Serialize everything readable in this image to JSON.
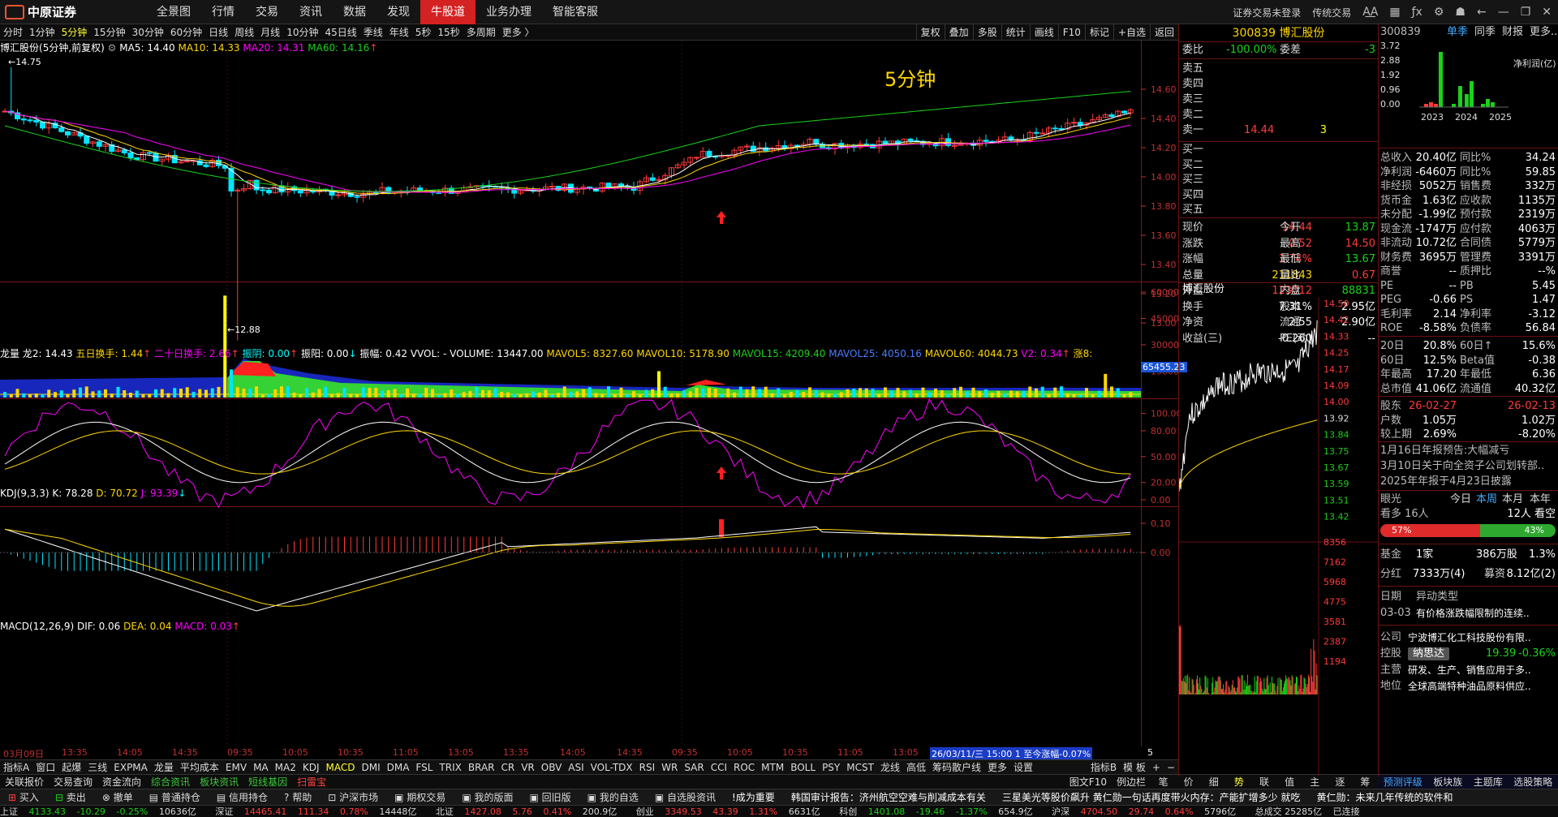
{
  "topbar": {
    "logo": "中原证券",
    "nav": [
      "全景图",
      "行情",
      "交易",
      "资讯",
      "数据",
      "发现",
      "牛股道",
      "业务办理",
      "智能客服"
    ],
    "active": "牛股道",
    "right": {
      "login": "证券交易未登录",
      "mode": "传统交易",
      "font": "A͜A"
    }
  },
  "periods": [
    "分时",
    "1分钟",
    "5分钟",
    "15分钟",
    "30分钟",
    "60分钟",
    "日线",
    "周线",
    "月线",
    "10分钟",
    "45日线",
    "季线",
    "年线",
    "5秒",
    "15秒",
    "多周期",
    "更多 〉"
  ],
  "active_period": "5分钟",
  "chart_tools": [
    "复权",
    "叠加",
    "多股",
    "统计",
    "画线",
    "F10",
    "标记",
    "+自选",
    "返回"
  ],
  "main": {
    "header": {
      "name": "博汇股份",
      "desc": "(5分钟,前复权)",
      "ma5": "MA5: 14.40",
      "ma10": "MA10: 14.33",
      "ma20": "MA20: 14.31",
      "ma60": "MA60: 14.16"
    },
    "period_label": "5分钟",
    "high_mark": "14.75",
    "low_mark": "12.88",
    "y_ticks": [
      "14.60",
      "14.40",
      "14.20",
      "14.00",
      "13.80",
      "13.60",
      "13.40",
      "13.20",
      "13.00"
    ]
  },
  "vol": {
    "header": {
      "name": "龙量",
      "l2": "龙2: 14.43",
      "l3": "五日换手: 1.44",
      "l4": "二十日换手: 2.66",
      "l5": "振阴: 0.00",
      "l6": "振阳: 0.00",
      "l7": "振幅: 0.42",
      "l8": "VVOL: - VOLUME: 13447.00",
      "l9": "MAVOL5: 8327.60",
      "l10": "MAVOL10: 5178.90",
      "l11": "MAVOL15: 4209.40",
      "l12": "MAVOL25: 4050.16",
      "l13": "MAVOL60: 4044.73",
      "l14": "V2: 0.34",
      "l15": "涨8:"
    },
    "top_badge": "65455.23",
    "y_ticks": [
      "60000",
      "45000",
      "30000",
      "15000"
    ]
  },
  "kdj": {
    "header": {
      "name": "KDJ(9,3,3)",
      "k": "K: 78.28",
      "d": "D: 70.72",
      "j": "J: 93.39"
    },
    "y_ticks": [
      "100.00",
      "80.00",
      "50.00",
      "20.00",
      "0.00"
    ]
  },
  "macd": {
    "header": {
      "name": "MACD(12,26,9)",
      "dif": "DIF: 0.06",
      "dea": "DEA: 0.04",
      "macd": "MACD: 0.03"
    },
    "y_ticks": [
      "0.10",
      "0.00"
    ]
  },
  "time_axis": {
    "labels": [
      "03月09日",
      "13:35",
      "14:05",
      "14:35",
      "09:35",
      "10:05",
      "10:35",
      "11:05",
      "13:05",
      "13:35",
      "14:05",
      "14:35",
      "09:35",
      "10:05",
      "10:35",
      "11:05",
      "13:05"
    ],
    "cursor": "26/03/11/三 15:00 1 至今涨幅-0.07%",
    "period": "5分钟"
  },
  "tabs": [
    "指标A",
    "窗口",
    "起爆",
    "三线",
    "EXPMA",
    "龙量",
    "平均成本",
    "EMV",
    "MA",
    "MA2",
    "KDJ",
    "MACD",
    "DMI",
    "DMA",
    "FSL",
    "TRIX",
    "BRAR",
    "CR",
    "VR",
    "OBV",
    "ASI",
    "VOL-TDX",
    "RSI",
    "WR",
    "SAR",
    "CCI",
    "ROC",
    "MTM",
    "BOLL",
    "PSY",
    "MCST",
    "龙线",
    "高低",
    "筹码散户线",
    "更多",
    "设置"
  ],
  "active_tab": "MACD",
  "tabs_right": [
    "指标B",
    "模 板",
    "+",
    "−"
  ],
  "funcbar": [
    "关联报价",
    "交易查询",
    "资金流向",
    "综合资讯",
    "板块资讯",
    "短线基因",
    "扫雷宝"
  ],
  "funcbar_right": [
    "图文F10",
    "例边栏"
  ],
  "funcbar_right_tabs": [
    "笔",
    "价",
    "细",
    "势",
    "联",
    "值",
    "主",
    "逐",
    "筹"
  ],
  "tradebar": [
    "买入",
    "卖出",
    "撤单",
    "普通持仓",
    "信用持仓",
    "帮助",
    "沪深市场",
    "期权交易",
    "我的版面",
    "回旧版",
    "我的自选",
    "自选股资讯"
  ],
  "news": [
    "!成为重要",
    "韩国审计报告：济州航空空难与削减成本有关",
    "三星美光等股价飙升 黄仁勋一句话再度带火内存：产能扩增多少 就吃",
    "黄仁勋：未来几年传统的软件和"
  ],
  "status": {
    "sh": "上证",
    "sh_v": "4133.43",
    "sh_c": "-10.29",
    "sh_p": "-0.25%",
    "sh_a": "10636亿",
    "sz": "深证",
    "sz_v": "14465.41",
    "sz_c": "111.34",
    "sz_p": "0.78%",
    "sz_a": "14448亿",
    "bz": "北证",
    "bz_v": "1427.08",
    "bz_c": "5.76",
    "bz_p": "0.41%",
    "bz_a": "200.9亿",
    "cy": "创业",
    "cy_v": "3349.53",
    "cy_c": "43.39",
    "cy_p": "1.31%",
    "cy_a": "6631亿",
    "kc": "科创",
    "kc_v": "1401.08",
    "kc_c": "-19.46",
    "kc_p": "-1.37%",
    "kc_a": "654.9亿",
    "hs": "沪深",
    "hs_v": "4704.50",
    "hs_c": "29.74",
    "hs_p": "0.64%",
    "hs_a": "5796亿",
    "misc": "总成交 25285亿",
    "conn": "已连接"
  },
  "quote": {
    "code": "300839",
    "name": "博汇股份",
    "webi": "委比",
    "webi_v": "-100.00%",
    "wecha": "委差",
    "wecha_v": "-3",
    "asks": [
      {
        "l": "卖五",
        "p": "",
        "v": ""
      },
      {
        "l": "卖四",
        "p": "",
        "v": ""
      },
      {
        "l": "卖三",
        "p": "",
        "v": ""
      },
      {
        "l": "卖二",
        "p": "",
        "v": ""
      },
      {
        "l": "卖一",
        "p": "14.44",
        "v": "3"
      }
    ],
    "bids": [
      {
        "l": "买一",
        "p": "",
        "v": ""
      },
      {
        "l": "买二",
        "p": "",
        "v": ""
      },
      {
        "l": "买三",
        "p": "",
        "v": ""
      },
      {
        "l": "买四",
        "p": "",
        "v": ""
      },
      {
        "l": "买五",
        "p": "",
        "v": ""
      }
    ],
    "stats": [
      {
        "a": "现价",
        "b": "14.44",
        "c": "今开",
        "d": "13.87"
      },
      {
        "a": "涨跌",
        "b": "0.52",
        "c": "最高",
        "d": "14.50"
      },
      {
        "a": "涨幅",
        "b": "3.74%",
        "c": "最低",
        "d": "13.67"
      },
      {
        "a": "总量",
        "b": "211843",
        "c": "量比",
        "d": "0.67"
      },
      {
        "a": "外盘",
        "b": "123012",
        "c": "内盘",
        "d": "88831"
      },
      {
        "a": "换手",
        "b": "7.31%",
        "c": "股本",
        "d": "2.95亿"
      },
      {
        "a": "净资",
        "b": "2.55",
        "c": "流通",
        "d": "2.90亿"
      },
      {
        "a": "收益(三)",
        "b": "-0.260",
        "c": "PE(动)",
        "d": "--"
      }
    ],
    "mini_title": "博汇股份",
    "mini_ticks": [
      "14.50",
      "14.42",
      "14.33",
      "14.25",
      "14.17",
      "14.09",
      "14.00",
      "13.92",
      "13.84",
      "13.75",
      "13.67",
      "13.59",
      "13.51",
      "13.42"
    ],
    "vol_ticks": [
      "8356",
      "7162",
      "5968",
      "4775",
      "3581",
      "2387",
      "1194"
    ]
  },
  "fin": {
    "code": "300839",
    "tabs": [
      "单季",
      "同季",
      "财报",
      "更多.."
    ],
    "chart": {
      "ticks": [
        "3.72",
        "2.88",
        "1.92",
        "0.96",
        "0.00"
      ],
      "years": [
        "2023",
        "2024",
        "2025"
      ],
      "label": "净利润(亿)"
    },
    "rows": [
      {
        "a": "总收入",
        "b": "20.40亿",
        "c": "同比%",
        "d": "34.24"
      },
      {
        "a": "净利润",
        "b": "-6460万",
        "c": "同比%",
        "d": "59.85"
      },
      {
        "a": "非经损",
        "b": "5052万",
        "c": "销售费",
        "d": "332万"
      },
      {
        "a": "货币金",
        "b": "1.63亿",
        "c": "应收款",
        "d": "1135万"
      },
      {
        "a": "未分配",
        "b": "-1.99亿",
        "c": "预付款",
        "d": "2319万"
      },
      {
        "a": "现金流",
        "b": "-1747万",
        "c": "应付款",
        "d": "4063万"
      },
      {
        "a": "非流动",
        "b": "10.72亿",
        "c": "合同债",
        "d": "5779万"
      },
      {
        "a": "财务费",
        "b": "3695万",
        "c": "管理费",
        "d": "3391万"
      },
      {
        "a": "商誉",
        "b": "--",
        "c": "质押比",
        "d": "--%"
      },
      {
        "a": "PE",
        "b": "--",
        "c": "PB",
        "d": "5.45"
      },
      {
        "a": "PEG",
        "b": "-0.66",
        "c": "PS",
        "d": "1.47"
      },
      {
        "a": "毛利率",
        "b": "2.14",
        "c": "净利率",
        "d": "-3.12"
      },
      {
        "a": "ROE",
        "b": "-8.58%",
        "c": "负债率",
        "d": "56.84"
      },
      {
        "a": "20日",
        "b": "20.8%",
        "c": "60日↑",
        "d": "15.6%"
      },
      {
        "a": "60日",
        "b": "12.5%",
        "c": "Beta值",
        "d": "-0.38"
      },
      {
        "a": "年最高",
        "b": "17.20",
        "c": "年最低",
        "d": "6.36"
      },
      {
        "a": "总市值",
        "b": "41.06亿",
        "c": "流通值",
        "d": "40.32亿"
      },
      {
        "a": "股东",
        "b": "26-02-27",
        "c": "",
        "d": "26-02-13"
      },
      {
        "a": "户数",
        "b": "1.05万",
        "c": "",
        "d": "1.02万"
      },
      {
        "a": "较上期",
        "b": "2.69%",
        "c": "",
        "d": "-8.20%"
      }
    ],
    "news": [
      "1月16日年报预告:大幅减亏",
      "3月10日关于向全资子公司划转部..",
      "2025年年报于4月23日披露"
    ],
    "eye": {
      "label": "眼光",
      "tabs": [
        "今日",
        "本周",
        "本月",
        "本年"
      ],
      "bull": "看多 16人",
      "bear": "12人 看空",
      "bull_pct": "57%",
      "bear_pct": "43%"
    },
    "fund": {
      "a": "基金",
      "b": "1家",
      "c": "386万股",
      "d": "1.3%"
    },
    "div": {
      "a": "分红",
      "b": "7333万(4)",
      "c": "募资",
      "d": "8.12亿(2)"
    },
    "alert": {
      "date_l": "日期",
      "type_l": "异动类型",
      "date": "03-03",
      "text": "有价格涨跌幅限制的连续.."
    },
    "company": {
      "a": "公司",
      "v": "宁波博汇化工科技股份有限.."
    },
    "ctrl": {
      "a": "控股",
      "v": "纳思达",
      "p": "19.39",
      "c": "-0.36%"
    },
    "biz": {
      "a": "主营",
      "v": "研发、生产、销售应用于多.."
    },
    "pos": {
      "a": "地位",
      "v": "全球高端特种油品原料供应.."
    },
    "bottom": [
      "预测评级",
      "板块族",
      "主题库",
      "选股策略"
    ]
  }
}
